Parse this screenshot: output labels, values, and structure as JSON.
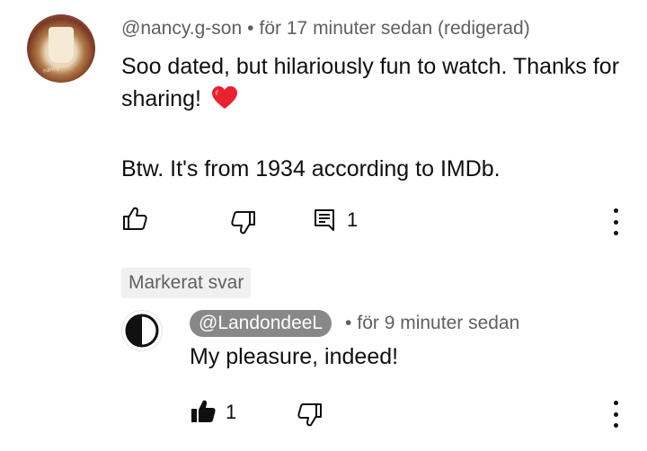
{
  "comment": {
    "author": "@nancy.g-son",
    "separator": "•",
    "time": "för 17 minuter sedan (redigerad)",
    "line1": "Soo dated, but hilariously fun to watch. Thanks for sharing!",
    "line2": "Btw. It's from 1934 according to IMDb.",
    "reply_count": "1",
    "icons": [
      "like-icon",
      "dislike-icon",
      "reply-icon",
      "more-icon"
    ],
    "heart_color": "#e8232f"
  },
  "highlight_badge": "Markerat svar",
  "reply": {
    "author": "@LandondeeL",
    "separator": "•",
    "time": "för 9 minuter sedan",
    "text": "My pleasure, indeed!",
    "like_count": "1",
    "icons": [
      "liked-icon",
      "dislike-icon",
      "more-icon"
    ],
    "author_chip_color": "#888888"
  }
}
